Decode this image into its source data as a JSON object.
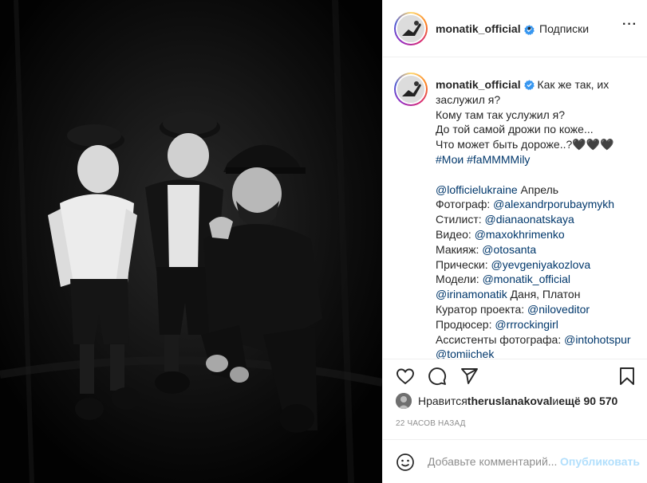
{
  "photo": {
    "alt": ""
  },
  "header": {
    "username": "monatik_official",
    "separator": "•",
    "follow_label": "Подписки",
    "more_label": "···"
  },
  "caption": {
    "username": "monatik_official",
    "lines": [
      "Как же так, их",
      "заслужил я?",
      "Кому там так услужил я?",
      "До той самой дрожи по коже...",
      "Что может быть дороже..?🖤🖤🖤"
    ],
    "hashtags": "#Мои #faMMMMily",
    "credits": {
      "magazine": "@lofficielukraine",
      "month": " Апрель",
      "photographer_label": "Фотограф: ",
      "photographer": "@alexandrporubaymykh",
      "stylist_label": "Стилист: ",
      "stylist": "@dianaonatskaya",
      "video_label": "Видео: ",
      "video": "@maxokhrimenko",
      "makeup_label": "Макияж: ",
      "makeup": "@otosanta",
      "hair_label": "Прически: ",
      "hair": "@yevgeniyakozlova",
      "models_label": "Модели: ",
      "model1": "@monatik_official",
      "model2": "@irinamonatik",
      "model2_suffix": " Даня, Платон",
      "curator_label": "Куратор проекта: ",
      "curator": "@niloveditor",
      "producer_label": "Продюсер: ",
      "producer": "@rrrockingirl",
      "assistants_label": "Ассистенты фотографа: ",
      "assistant1": "@intohotspur",
      "assistant2": "@tomiichek"
    }
  },
  "icons": {
    "like": "heart-icon",
    "comment": "comment-icon",
    "share": "share-icon",
    "save": "bookmark-icon",
    "emoji": "smiley-icon",
    "verified": "verified-badge-icon"
  },
  "likes": {
    "prefix": "Нравится ",
    "user": "theruslanakoval",
    "middle": " и ",
    "rest": "ещё 90 570"
  },
  "timestamp": "22 часов назад",
  "comment": {
    "placeholder": "Добавьте комментарий...",
    "publish_label": "Опубликовать"
  },
  "colors": {
    "link": "#00376b",
    "verified": "#3897f0",
    "publish_disabled": "#b2dffc",
    "muted": "#8e8e8e"
  }
}
